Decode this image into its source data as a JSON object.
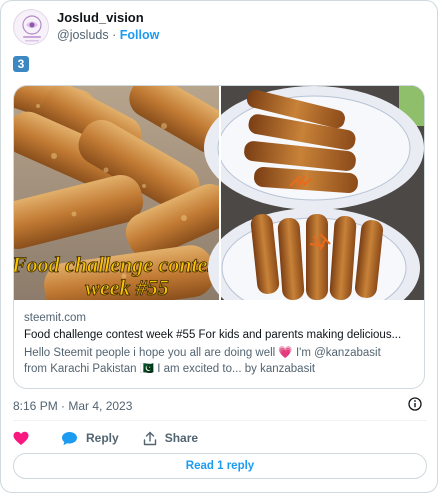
{
  "author": {
    "display_name": "Joslud_vision",
    "handle": "@josluds",
    "separator": "·",
    "follow_label": "Follow"
  },
  "tweet": {
    "badge": "3",
    "timestamp": "8:16 PM · Mar 4, 2023"
  },
  "card": {
    "image_caption_line1": "Food challenge contest",
    "image_caption_line2": "week #55",
    "domain": "steemit.com",
    "title": "Food challenge contest week #55 For kids and parents making delicious...",
    "description_line1": "Hello Steemit people i hope you all are doing well 💗 I'm @kanzabasit",
    "description_line2": "from Karachi Pakistan 🇵🇰 I am excited to... by kanzabasit"
  },
  "actions": {
    "like_label": "",
    "reply_label": "Reply",
    "share_label": "Share",
    "read_replies_label": "Read 1 reply"
  },
  "colors": {
    "accent": "#1d9bf0",
    "like": "#f91880",
    "muted": "#536471",
    "badge": "#3b88c3"
  }
}
